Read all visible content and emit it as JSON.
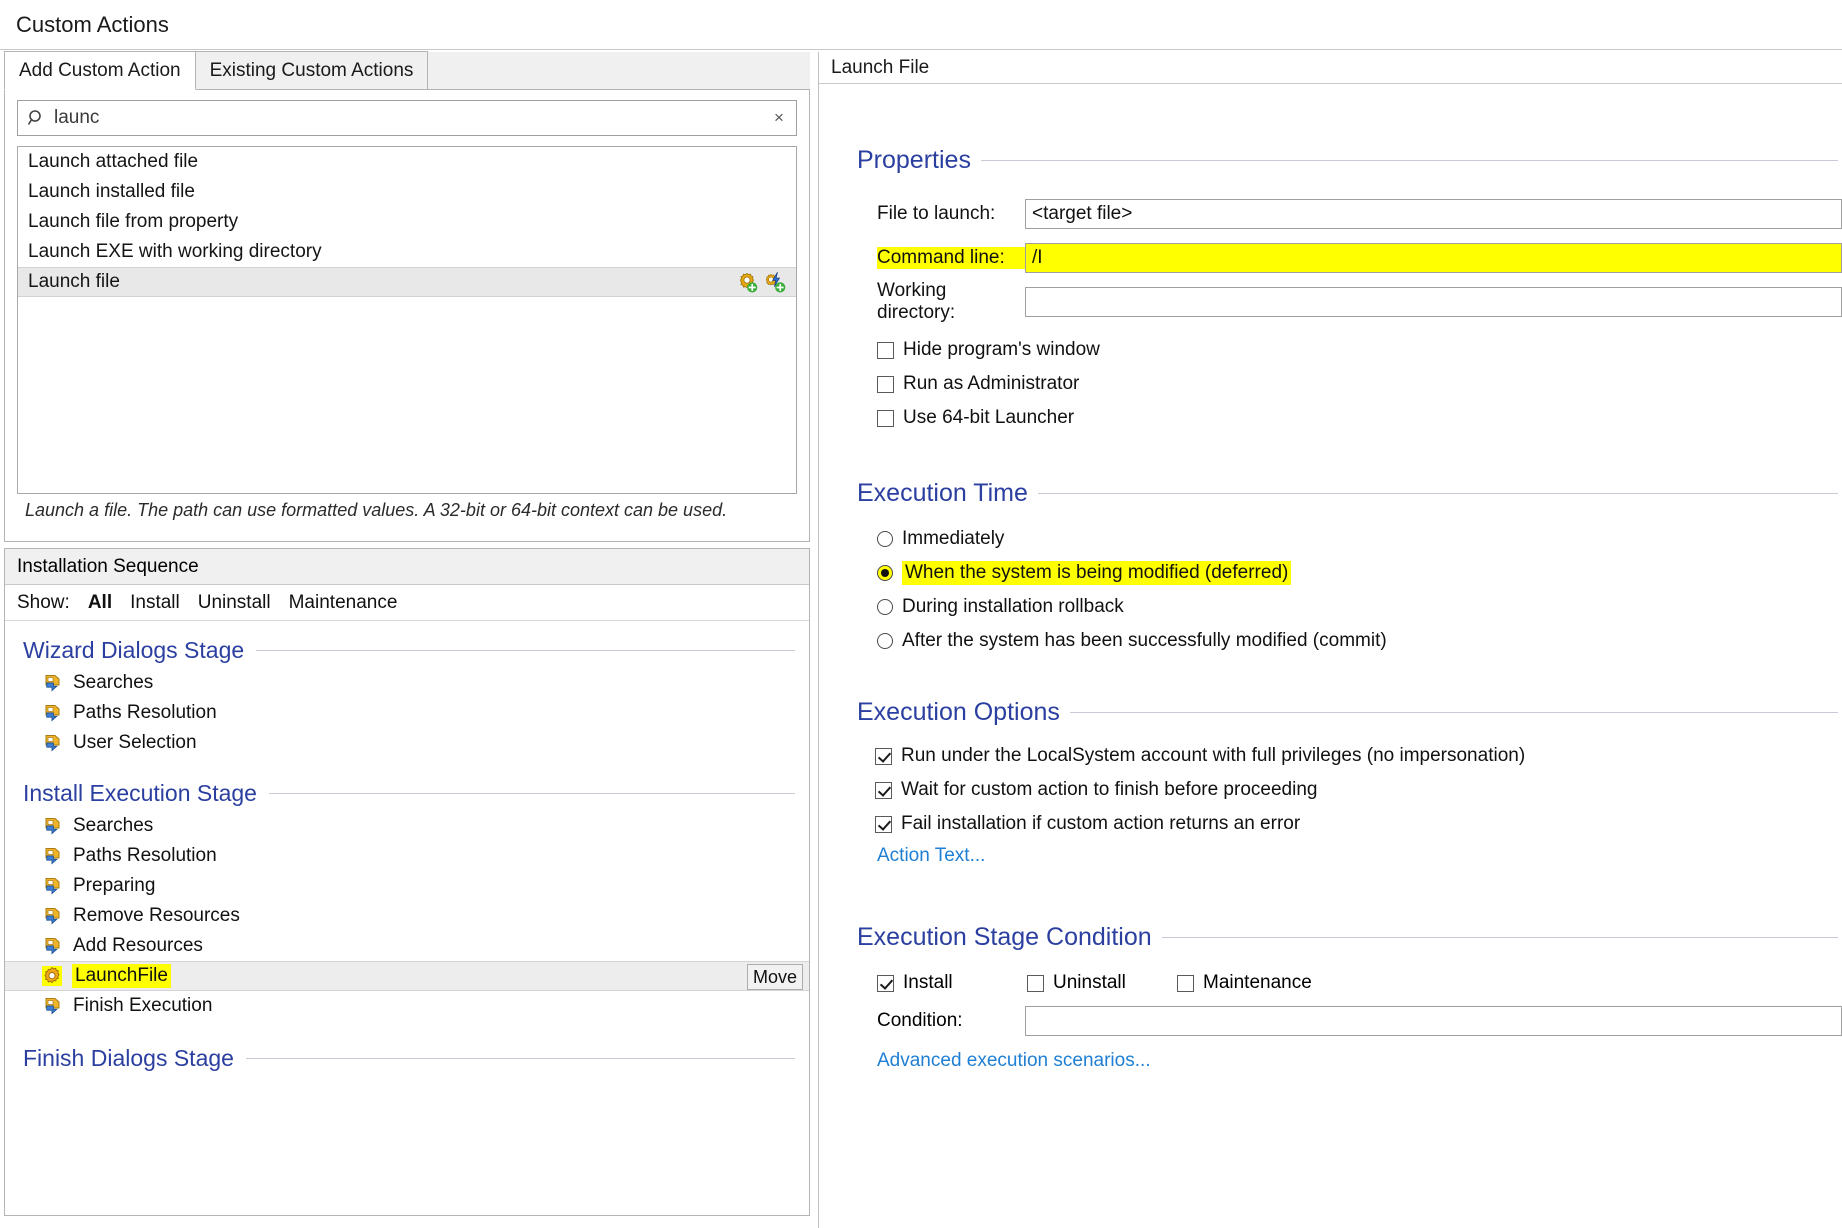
{
  "window": {
    "title": "Custom Actions"
  },
  "left": {
    "tabs": [
      {
        "label": "Add Custom Action",
        "active": true
      },
      {
        "label": "Existing Custom Actions",
        "active": false
      }
    ],
    "search": {
      "value": "launc",
      "placeholder": "",
      "icon": "search-icon",
      "clear": "×"
    },
    "results": [
      {
        "label": "Launch attached file",
        "selected": false
      },
      {
        "label": "Launch installed file",
        "selected": false
      },
      {
        "label": "Launch file from property",
        "selected": false
      },
      {
        "label": "Launch EXE with working directory",
        "selected": false
      },
      {
        "label": "Launch file",
        "selected": true
      }
    ],
    "description": "Launch a file. The path can use formatted values. A 32-bit or 64-bit context can be used.",
    "sequence": {
      "header": "Installation Sequence",
      "show_label": "Show:",
      "show_options": [
        {
          "label": "All",
          "active": true
        },
        {
          "label": "Install",
          "active": false
        },
        {
          "label": "Uninstall",
          "active": false
        },
        {
          "label": "Maintenance",
          "active": false
        }
      ],
      "stages": [
        {
          "title": "Wizard Dialogs Stage",
          "items": [
            {
              "label": "Searches",
              "icon": "action-arrow-icon",
              "selected": false,
              "highlight": false
            },
            {
              "label": "Paths Resolution",
              "icon": "action-arrow-icon",
              "selected": false,
              "highlight": false
            },
            {
              "label": "User Selection",
              "icon": "action-arrow-icon",
              "selected": false,
              "highlight": false
            }
          ]
        },
        {
          "title": "Install Execution Stage",
          "items": [
            {
              "label": "Searches",
              "icon": "action-arrow-icon",
              "selected": false,
              "highlight": false
            },
            {
              "label": "Paths Resolution",
              "icon": "action-arrow-icon",
              "selected": false,
              "highlight": false
            },
            {
              "label": "Preparing",
              "icon": "action-arrow-icon",
              "selected": false,
              "highlight": false
            },
            {
              "label": "Remove Resources",
              "icon": "action-arrow-icon",
              "selected": false,
              "highlight": false
            },
            {
              "label": "Add Resources",
              "icon": "action-arrow-icon",
              "selected": false,
              "highlight": false
            },
            {
              "label": "LaunchFile",
              "icon": "gear-icon",
              "selected": true,
              "highlight": true,
              "move_label": "Move"
            },
            {
              "label": "Finish Execution",
              "icon": "action-arrow-icon",
              "selected": false,
              "highlight": false
            }
          ]
        },
        {
          "title": "Finish Dialogs Stage",
          "items": []
        }
      ]
    }
  },
  "right": {
    "header": "Launch File",
    "properties": {
      "title": "Properties",
      "file_to_launch_label": "File to launch:",
      "file_to_launch_value": "<target file>",
      "command_line_label": "Command line:",
      "command_line_value": "/I",
      "working_directory_label": "Working directory:",
      "working_directory_value": "",
      "checkboxes": [
        {
          "label": "Hide program's window",
          "checked": false
        },
        {
          "label": "Run as Administrator",
          "checked": false
        },
        {
          "label": "Use 64-bit Launcher",
          "checked": false
        }
      ]
    },
    "execution_time": {
      "title": "Execution Time",
      "options": [
        {
          "label": "Immediately",
          "selected": false,
          "highlight": false
        },
        {
          "label": "When the system is being modified (deferred)",
          "selected": true,
          "highlight": true
        },
        {
          "label": "During installation rollback",
          "selected": false,
          "highlight": false
        },
        {
          "label": "After the system has been successfully modified (commit)",
          "selected": false,
          "highlight": false
        }
      ]
    },
    "execution_options": {
      "title": "Execution Options",
      "checkboxes": [
        {
          "label": "Run under the LocalSystem account with full privileges (no impersonation)",
          "checked": true
        },
        {
          "label": "Wait for custom action to finish before proceeding",
          "checked": true
        },
        {
          "label": "Fail installation if custom action returns an error",
          "checked": true
        }
      ],
      "action_text_link": "Action Text..."
    },
    "execution_stage_condition": {
      "title": "Execution Stage Condition",
      "checkboxes": [
        {
          "label": "Install",
          "checked": true
        },
        {
          "label": "Uninstall",
          "checked": false
        },
        {
          "label": "Maintenance",
          "checked": false
        }
      ],
      "condition_label": "Condition:",
      "condition_value": "",
      "advanced_link": "Advanced execution scenarios..."
    }
  },
  "colors": {
    "group_heading": "#2b3fa0",
    "link": "#1f7fd4",
    "highlight": "#ffff00",
    "selection": "#e8e8e8"
  }
}
